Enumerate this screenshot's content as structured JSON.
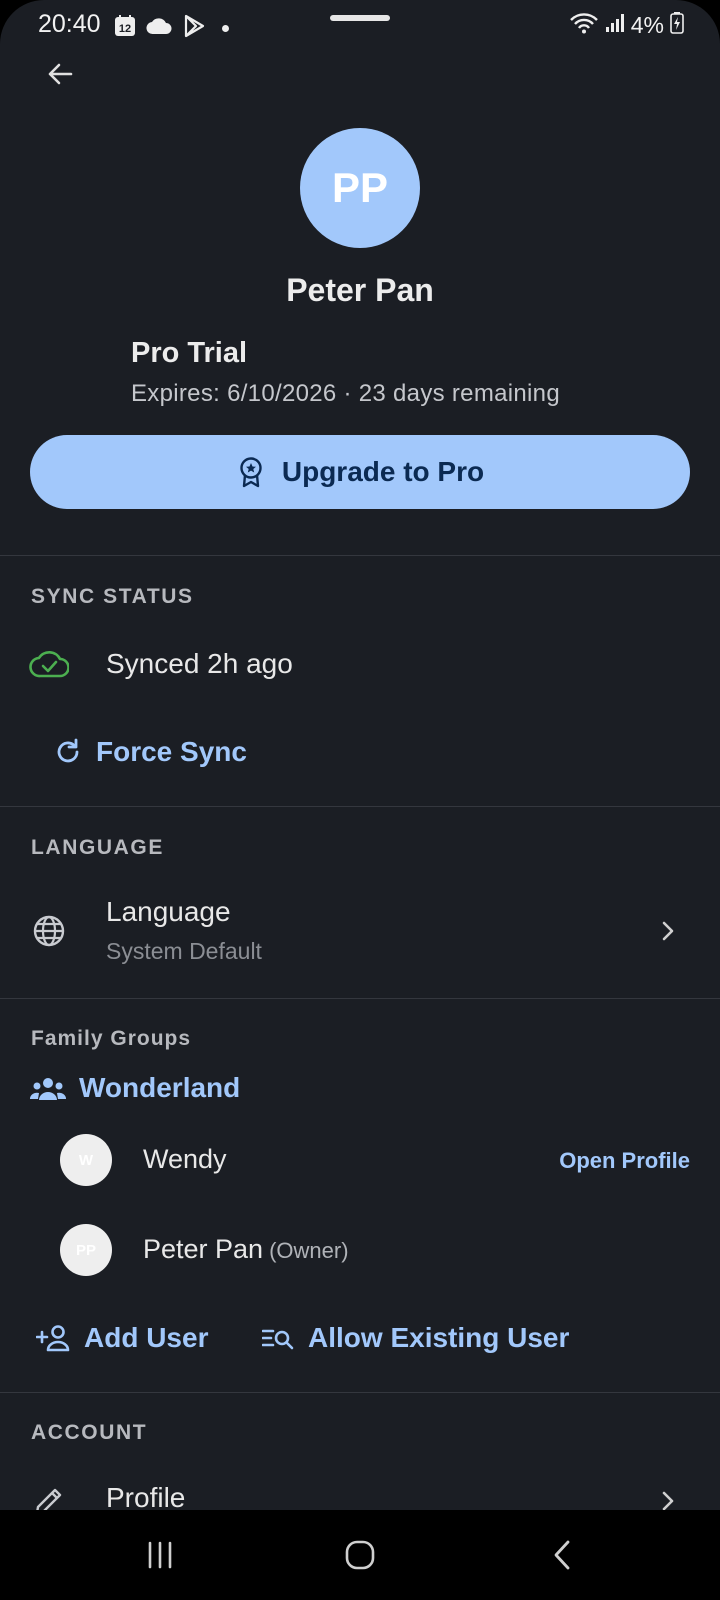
{
  "status_bar": {
    "time": "20:40",
    "calendar_day": "12",
    "battery": "4%",
    "icons": [
      "calendar-icon",
      "cloud-icon",
      "play-store-icon",
      "wifi-icon",
      "signal-icon",
      "battery-charging-icon"
    ]
  },
  "header": {
    "back_icon": "arrow-back-icon"
  },
  "profile": {
    "initials": "PP",
    "name": "Peter Pan",
    "plan_title": "Pro Trial",
    "plan_expiry": "Expires: 6/10/2026 · 23 days remaining",
    "upgrade_label": "Upgrade to Pro",
    "colors": {
      "accent": "#a2c8fb",
      "background": "#1b1e24",
      "synced": "#4caf50"
    }
  },
  "sync": {
    "section_title": "SYNC STATUS",
    "status_text": "Synced 2h ago",
    "force_sync_label": "Force Sync"
  },
  "language": {
    "section_title": "LANGUAGE",
    "label": "Language",
    "value": "System Default"
  },
  "family": {
    "section_title": "Family Groups",
    "group_name": "Wonderland",
    "members": [
      {
        "initials": "W",
        "name": "Wendy",
        "role": "",
        "action": "Open Profile"
      },
      {
        "initials": "PP",
        "name": "Peter Pan",
        "role": "(Owner)",
        "action": ""
      }
    ],
    "add_user_label": "Add User",
    "allow_existing_label": "Allow Existing User"
  },
  "account": {
    "section_title": "ACCOUNT",
    "profile_label": "Profile"
  }
}
